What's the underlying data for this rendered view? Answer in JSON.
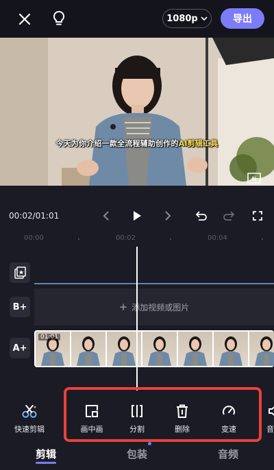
{
  "header": {
    "resolution": "1080p",
    "export_label": "导出"
  },
  "preview": {
    "caption_main": "今天为你介绍一款全流程辅助创作的",
    "caption_highlight": "AI剪辑工具"
  },
  "playback": {
    "time": "00:02/01:01"
  },
  "ruler": {
    "ticks": [
      "00:00",
      "00:02",
      "00:04"
    ]
  },
  "tracks": {
    "text_track_label": "B+",
    "audio_track_label": "A+",
    "add_media_label": "添加视频或图片",
    "clip_duration": "01:01"
  },
  "toolbar": {
    "items": [
      {
        "label": "快速剪辑",
        "icon": "scissors-icon"
      },
      {
        "label": "画中画",
        "icon": "picture-in-picture-icon"
      },
      {
        "label": "分割",
        "icon": "split-icon"
      },
      {
        "label": "删除",
        "icon": "trash-icon"
      },
      {
        "label": "变速",
        "icon": "speed-icon"
      },
      {
        "label": "音",
        "icon": "volume-icon"
      }
    ]
  },
  "tabs": [
    {
      "label": "剪辑",
      "active": true
    },
    {
      "label": "包装",
      "active": false
    },
    {
      "label": "音频",
      "active": false
    }
  ],
  "colors": {
    "accent": "#7c7cf8",
    "highlight_border": "#e8423a",
    "background": "#1b1b25"
  }
}
